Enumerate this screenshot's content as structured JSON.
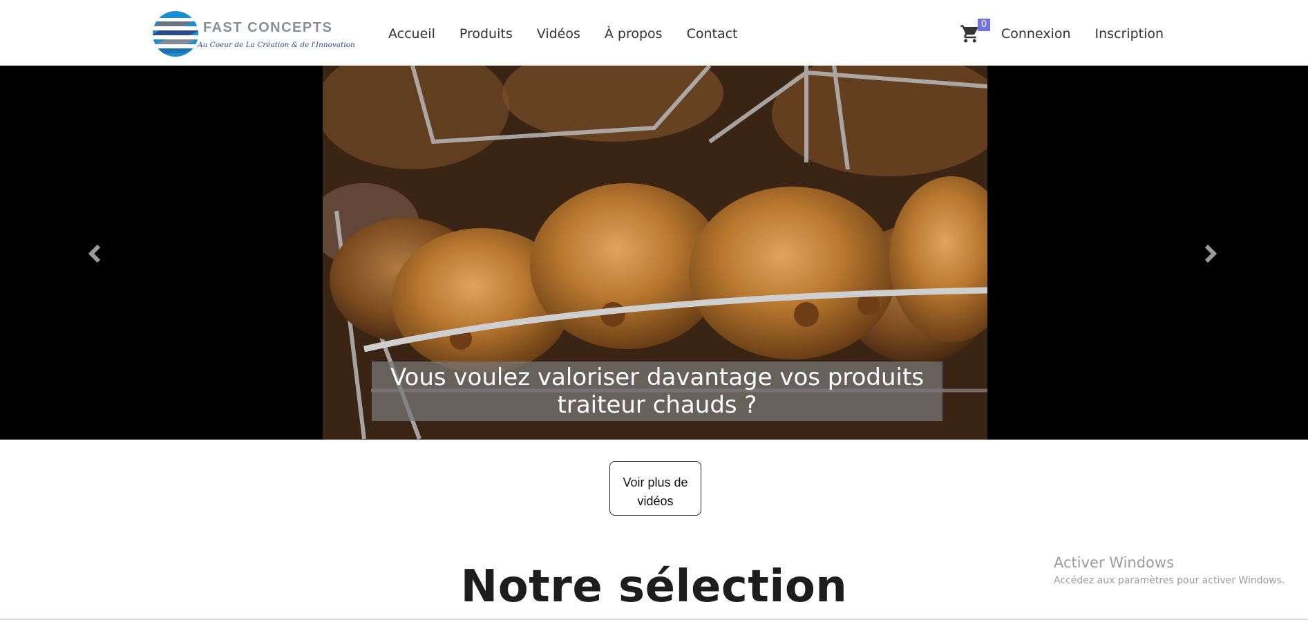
{
  "header": {
    "logo": {
      "name": "FAST CONCEPTS",
      "tagline": "Au Coeur de La Création & de l'Innovation",
      "colors": {
        "primary": "#1a8fd0",
        "dark": "#2b4a8a",
        "grey": "#8a8f96"
      }
    },
    "nav": [
      {
        "label": "Accueil"
      },
      {
        "label": "Produits"
      },
      {
        "label": "Vidéos"
      },
      {
        "label": "À propos"
      },
      {
        "label": "Contact"
      }
    ],
    "cart": {
      "icon": "cart-icon",
      "count": "0",
      "badge_color": "#6f73e3"
    },
    "auth": {
      "login": "Connexion",
      "register": "Inscription"
    }
  },
  "carousel": {
    "caption": "Vous voulez valoriser davantage vos produits traiteur chauds ?",
    "prev_icon": "chevron-left-icon",
    "next_icon": "chevron-right-icon",
    "image_subject": "rotisserie-chickens"
  },
  "videos_button": {
    "label": "Voir plus de vidéos"
  },
  "section": {
    "title": "Notre sélection"
  },
  "watermark": {
    "title": "Activer Windows",
    "subtitle": "Accédez aux paramètres pour activer Windows."
  }
}
